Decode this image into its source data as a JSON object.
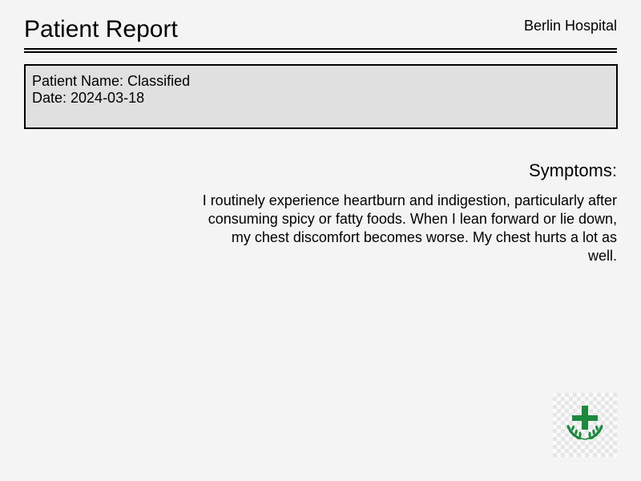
{
  "header": {
    "title": "Patient Report",
    "hospital": "Berlin Hospital"
  },
  "patient": {
    "name_line": "Patient Name: Classified",
    "date_line": "Date: 2024-03-18"
  },
  "symptoms": {
    "heading": "Symptoms:",
    "text": "I routinely experience heartburn and indigestion, particularly after consuming spicy or fatty foods. When I lean forward or lie down, my chest discomfort becomes worse. My chest hurts a lot as well."
  },
  "logo": {
    "icon": "medical-cross-laurel-icon",
    "color": "#1b8a3e"
  }
}
